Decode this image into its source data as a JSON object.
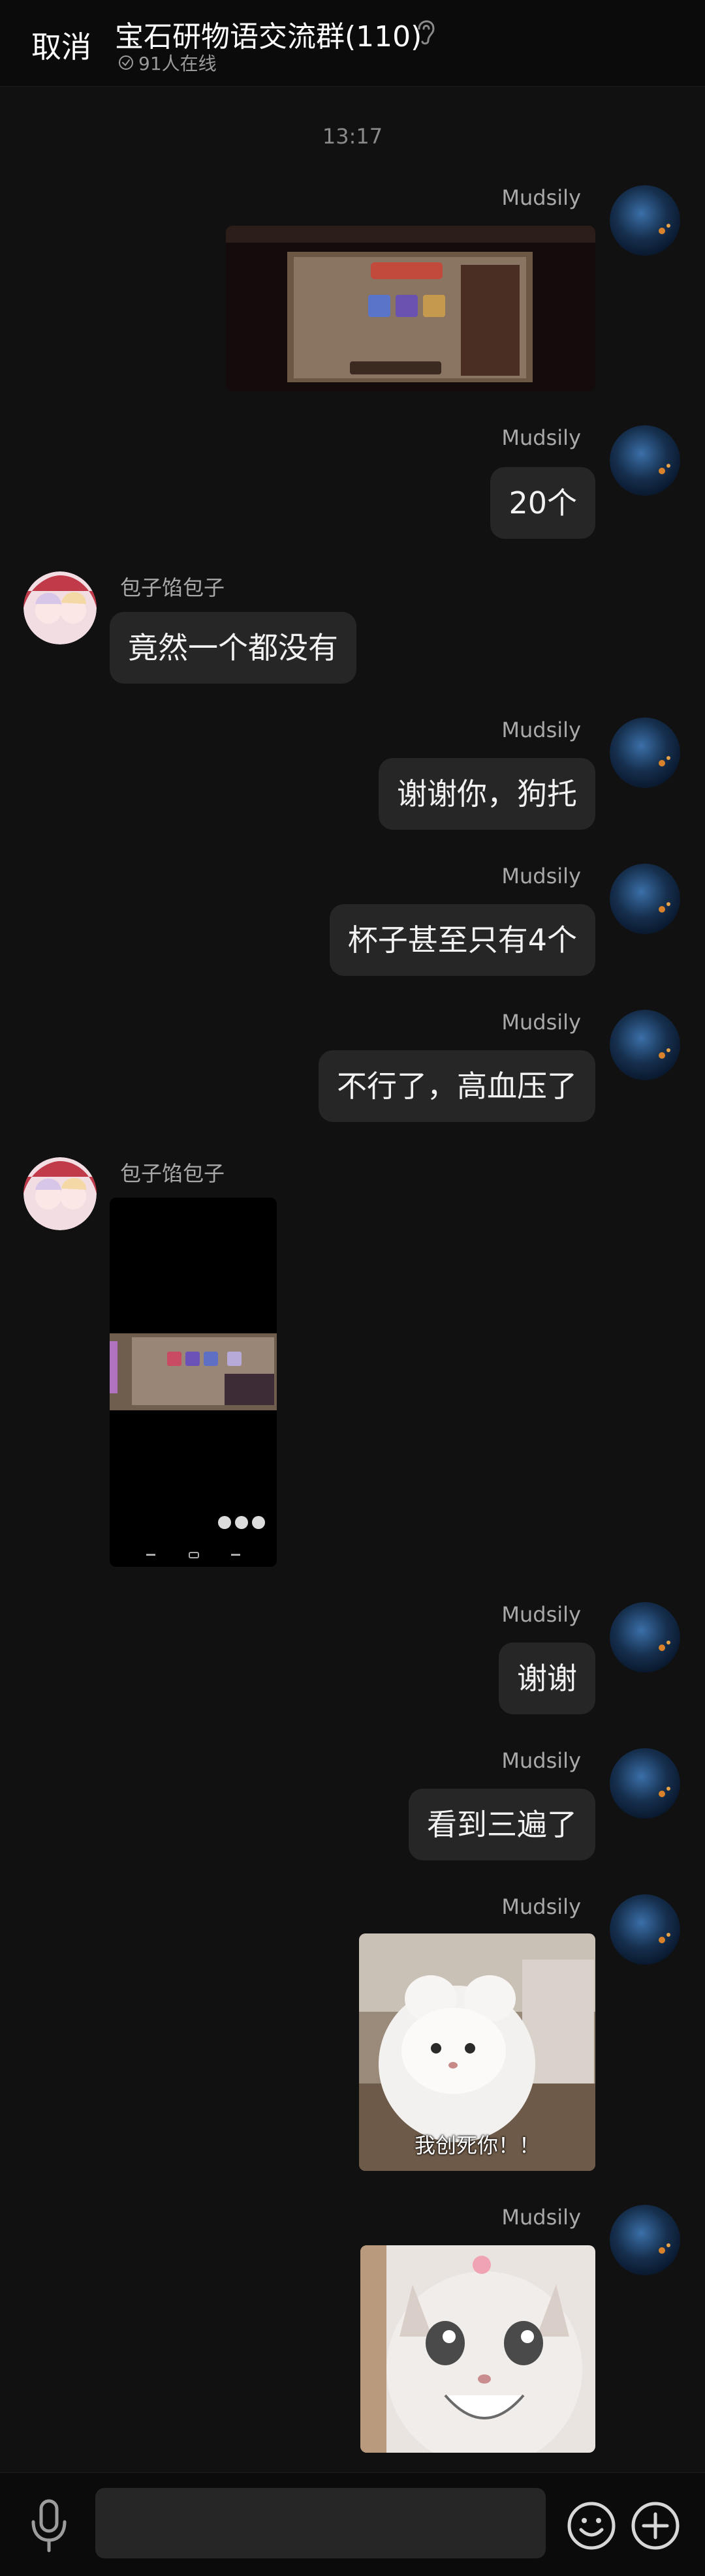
{
  "header": {
    "cancel_label": "取消",
    "title": "宝石研物语交流群(110)",
    "online_text": "91人在线"
  },
  "timestamp": "13:17",
  "messages": [
    {
      "sender": "Mudsily",
      "side": "right",
      "type": "image"
    },
    {
      "sender": "Mudsily",
      "side": "right",
      "type": "text",
      "text": "20个"
    },
    {
      "sender": "包子馅包子",
      "side": "left",
      "type": "text",
      "text": "竟然一个都没有"
    },
    {
      "sender": "Mudsily",
      "side": "right",
      "type": "text",
      "text": "谢谢你，狗托"
    },
    {
      "sender": "Mudsily",
      "side": "right",
      "type": "text",
      "text": "杯子甚至只有4个"
    },
    {
      "sender": "Mudsily",
      "side": "right",
      "type": "text",
      "text": "不行了，高血压了"
    },
    {
      "sender": "包子馅包子",
      "side": "left",
      "type": "image"
    },
    {
      "sender": "Mudsily",
      "side": "right",
      "type": "text",
      "text": "谢谢"
    },
    {
      "sender": "Mudsily",
      "side": "right",
      "type": "text",
      "text": "看到三遍了"
    },
    {
      "sender": "Mudsily",
      "side": "right",
      "type": "image",
      "caption": "我创死你！！"
    },
    {
      "sender": "Mudsily",
      "side": "right",
      "type": "image"
    }
  ],
  "input": {
    "placeholder": "",
    "value": ""
  },
  "icons": {
    "hearing": "ear-icon",
    "online": "online-icon",
    "voice": "microphone-icon",
    "emoji": "emoji-icon",
    "more": "plus-icon"
  },
  "colors": {
    "background": "#111111",
    "bubble": "#262626",
    "header": "#0b0b0b"
  }
}
